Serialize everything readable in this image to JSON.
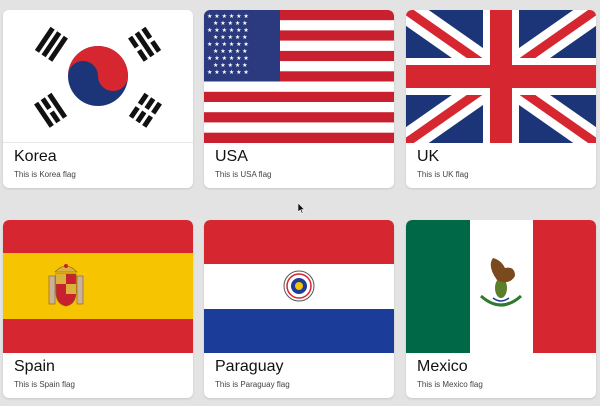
{
  "cards": [
    {
      "name": "Korea",
      "description": "This is Korea flag"
    },
    {
      "name": "USA",
      "description": "This is USA flag"
    },
    {
      "name": "UK",
      "description": "This is UK flag"
    },
    {
      "name": "Spain",
      "description": "This is Spain flag"
    },
    {
      "name": "Paraguay",
      "description": "This is Paraguay flag"
    },
    {
      "name": "Mexico",
      "description": "This is Mexico flag"
    }
  ],
  "colors": {
    "background": "#e3e3e3",
    "card": "#ffffff",
    "red": "#d62630",
    "blue": "#1c3578",
    "yellow": "#f2c300",
    "green": "#006847"
  },
  "icons": [
    "korea-flag-icon",
    "usa-flag-icon",
    "uk-flag-icon",
    "spain-flag-icon",
    "paraguay-flag-icon",
    "mexico-flag-icon",
    "mouse-pointer-icon"
  ]
}
